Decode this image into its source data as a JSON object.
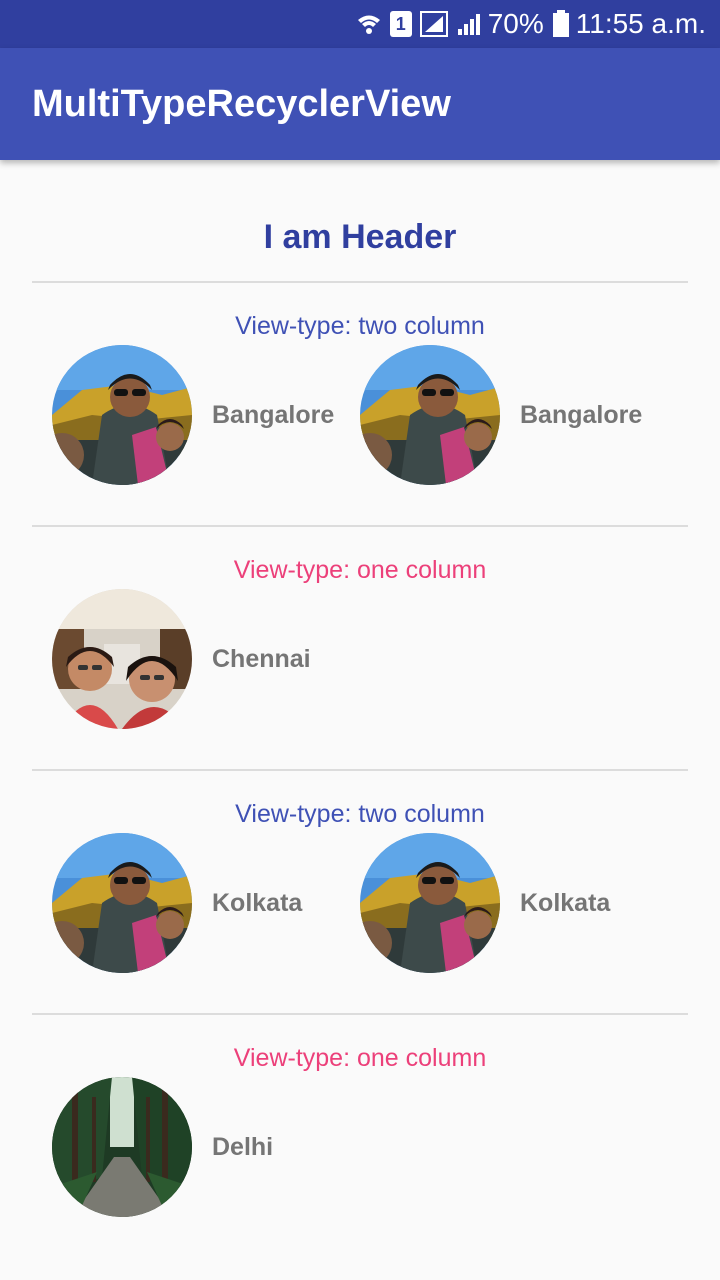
{
  "status_bar": {
    "battery": "70%",
    "time": "11:55 a.m.",
    "sim_slot": "1"
  },
  "app_bar": {
    "title": "MultiTypeRecyclerView"
  },
  "list": {
    "header": "I am Header",
    "sections": [
      {
        "type": "two-column",
        "title": "View-type: two column",
        "items": [
          {
            "city": "Bangalore"
          },
          {
            "city": "Bangalore"
          }
        ]
      },
      {
        "type": "one-column",
        "title": "View-type: one column",
        "items": [
          {
            "city": "Chennai"
          }
        ]
      },
      {
        "type": "two-column",
        "title": "View-type: two column",
        "items": [
          {
            "city": "Kolkata"
          },
          {
            "city": "Kolkata"
          }
        ]
      },
      {
        "type": "one-column",
        "title": "View-type: one column",
        "items": [
          {
            "city": "Delhi"
          }
        ]
      }
    ]
  },
  "colors": {
    "primary": "#3f51b5",
    "primary_dark": "#303f9f",
    "accent_pink": "#ec407a",
    "city_text": "#757575"
  }
}
